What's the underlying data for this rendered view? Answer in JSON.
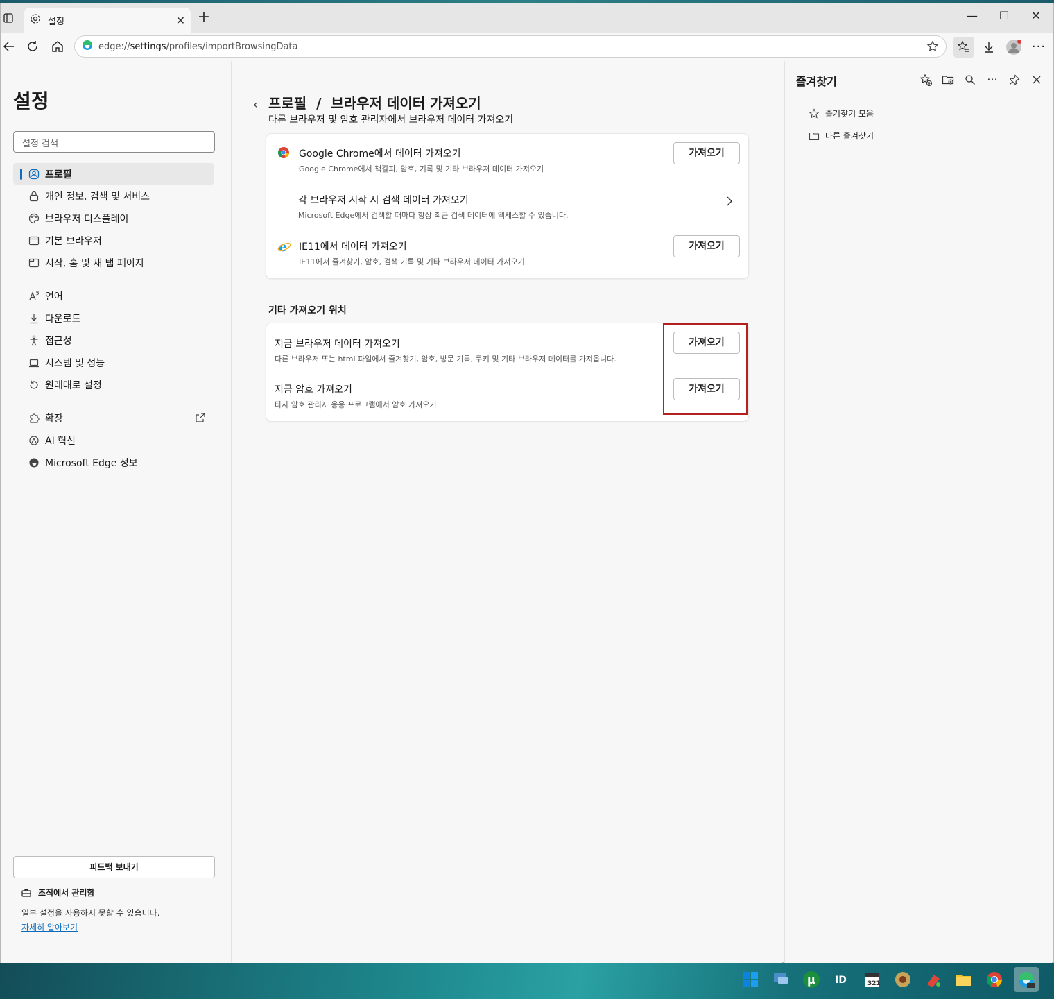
{
  "tab": {
    "title": "설정"
  },
  "address": {
    "prefix": "edge://",
    "host": "settings",
    "path": "/profiles/importBrowsingData"
  },
  "sidebar": {
    "title": "설정",
    "search_placeholder": "설정 검색",
    "items": [
      {
        "label": "프로필",
        "icon": "profile-icon"
      },
      {
        "label": "개인 정보, 검색 및 서비스",
        "icon": "lock-icon"
      },
      {
        "label": "브라우저 디스플레이",
        "icon": "palette-icon"
      },
      {
        "label": "기본 브라우저",
        "icon": "browser-icon"
      },
      {
        "label": "시작, 홈 및 새 탭 페이지",
        "icon": "home-tab-icon"
      },
      {
        "label": "언어",
        "icon": "language-icon"
      },
      {
        "label": "다운로드",
        "icon": "download-icon"
      },
      {
        "label": "접근성",
        "icon": "accessibility-icon"
      },
      {
        "label": "시스템 및 성능",
        "icon": "laptop-icon"
      },
      {
        "label": "원래대로 설정",
        "icon": "reset-icon"
      },
      {
        "label": "확장",
        "icon": "puzzle-icon"
      },
      {
        "label": "AI 혁신",
        "icon": "ai-icon"
      },
      {
        "label": "Microsoft Edge 정보",
        "icon": "edge-icon"
      }
    ],
    "feedback": "피드백 보내기",
    "managed_title": "조직에서 관리함",
    "managed_desc": "일부 설정을 사용하지 못할 수 있습니다.",
    "learn_more": "자세히 알아보기"
  },
  "main": {
    "breadcrumb": "프로필  /  브라우저 데이터 가져오기",
    "subtitle": "다른 브라우저 및 암호 관리자에서 브라우저 데이터 가져오기",
    "card1": [
      {
        "title": "Google Chrome에서 데이터 가져오기",
        "desc": "Google Chrome에서 책갈피, 암호, 기록 및 기타 브라우저 데이터 가져오기",
        "button": "가져오기"
      },
      {
        "title": "각 브라우저 시작 시 검색 데이터 가져오기",
        "desc": "Microsoft Edge에서 검색할 때마다 항상 최근 검색 데이터에 액세스할 수 있습니다."
      },
      {
        "title": "IE11에서 데이터 가져오기",
        "desc": "IE11에서 즐겨찾기, 암호, 검색 기록 및 기타 브라우저 데이터 가져오기",
        "button": "가져오기"
      }
    ],
    "section_title": "기타 가져오기 위치",
    "card2": [
      {
        "title": "지금 브라우저 데이터 가져오기",
        "desc": "다른 브라우저 또는 html 파일에서 즐겨찾기, 암호, 방문 기록, 쿠키 및 기타 브라우저 데이터를 가져옵니다.",
        "button": "가져오기"
      },
      {
        "title": "지금 암호 가져오기",
        "desc": "타사 암호 관리자 응용 프로그램에서 암호 가져오기",
        "button": "가져오기"
      }
    ]
  },
  "favorites": {
    "title": "즐겨찾기",
    "items": [
      {
        "label": "즐겨찾기 모음",
        "icon": "star-icon"
      },
      {
        "label": "다른 즐겨찾기",
        "icon": "folder-icon"
      }
    ]
  },
  "colors": {
    "accent": "#0f6cbd",
    "highlight": "#b32020"
  }
}
